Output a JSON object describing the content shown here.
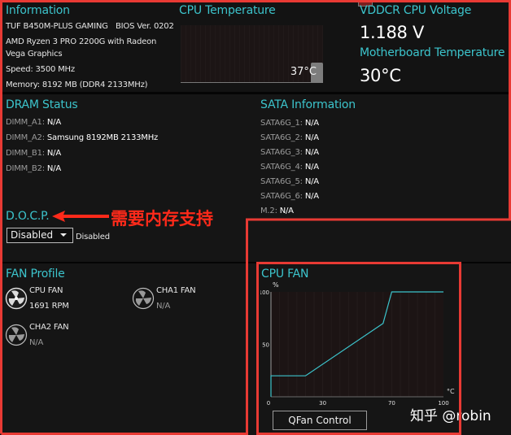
{
  "information": {
    "title": "Information",
    "board": "TUF B450M-PLUS GAMING",
    "bios": "BIOS Ver. 0202",
    "cpu_line1": "AMD Ryzen 3 PRO 2200G with Radeon",
    "cpu_line2": "Vega Graphics",
    "speed": "Speed: 3500 MHz",
    "memory": "Memory: 8192 MB (DDR4 2133MHz)"
  },
  "cpu_temperature": {
    "title": "CPU Temperature",
    "value": "37°C"
  },
  "voltage": {
    "title": "VDDCR CPU Voltage",
    "value": "1.188 V"
  },
  "mb_temperature": {
    "title": "Motherboard Temperature",
    "value": "30°C"
  },
  "dram": {
    "title": "DRAM Status",
    "slots": [
      {
        "label": "DIMM_A1:",
        "value": "N/A"
      },
      {
        "label": "DIMM_A2:",
        "value": "Samsung 8192MB 2133MHz"
      },
      {
        "label": "DIMM_B1:",
        "value": "N/A"
      },
      {
        "label": "DIMM_B2:",
        "value": "N/A"
      }
    ]
  },
  "sata": {
    "title": "SATA Information",
    "ports": [
      {
        "label": "SATA6G_1:",
        "value": "N/A"
      },
      {
        "label": "SATA6G_2:",
        "value": "N/A"
      },
      {
        "label": "SATA6G_3:",
        "value": "N/A"
      },
      {
        "label": "SATA6G_4:",
        "value": "N/A"
      },
      {
        "label": "SATA6G_5:",
        "value": "N/A"
      },
      {
        "label": "SATA6G_6:",
        "value": "N/A"
      },
      {
        "label": "M.2:",
        "value": "N/A"
      }
    ]
  },
  "docp": {
    "title": "D.O.C.P.",
    "selected": "Disabled",
    "status": "Disabled",
    "annotation": "需要内存支持"
  },
  "fan_profile": {
    "title": "FAN Profile",
    "fans": [
      {
        "name": "CPU FAN",
        "value": "1691 RPM",
        "icon": "fan-active-icon"
      },
      {
        "name": "CHA1 FAN",
        "value": "N/A",
        "icon": "fan-icon"
      },
      {
        "name": "CHA2 FAN",
        "value": "N/A",
        "icon": "fan-icon"
      }
    ]
  },
  "cpu_fan_curve": {
    "title": "CPU FAN",
    "button": "QFan Control"
  },
  "watermark": "知乎 @robin",
  "colors": {
    "accent": "#3cc4cc",
    "highlight": "#e83a34",
    "curve": "#3cc4cc"
  },
  "chart_data": {
    "type": "line",
    "title": "CPU FAN",
    "xlabel": "°C",
    "ylabel": "%",
    "xlim": [
      0,
      100
    ],
    "ylim": [
      0,
      100
    ],
    "xticks": [
      0,
      30,
      70,
      100
    ],
    "yticks": [
      50,
      100
    ],
    "ytick_labels": [
      "50",
      "100"
    ],
    "xtick_labels": [
      "0",
      "30",
      "70",
      "100"
    ],
    "grid": true,
    "series": [
      {
        "name": "CPU FAN",
        "x": [
          0,
          0,
          20,
          65,
          70,
          100
        ],
        "y": [
          0,
          20,
          20,
          70,
          100,
          100
        ]
      }
    ]
  }
}
